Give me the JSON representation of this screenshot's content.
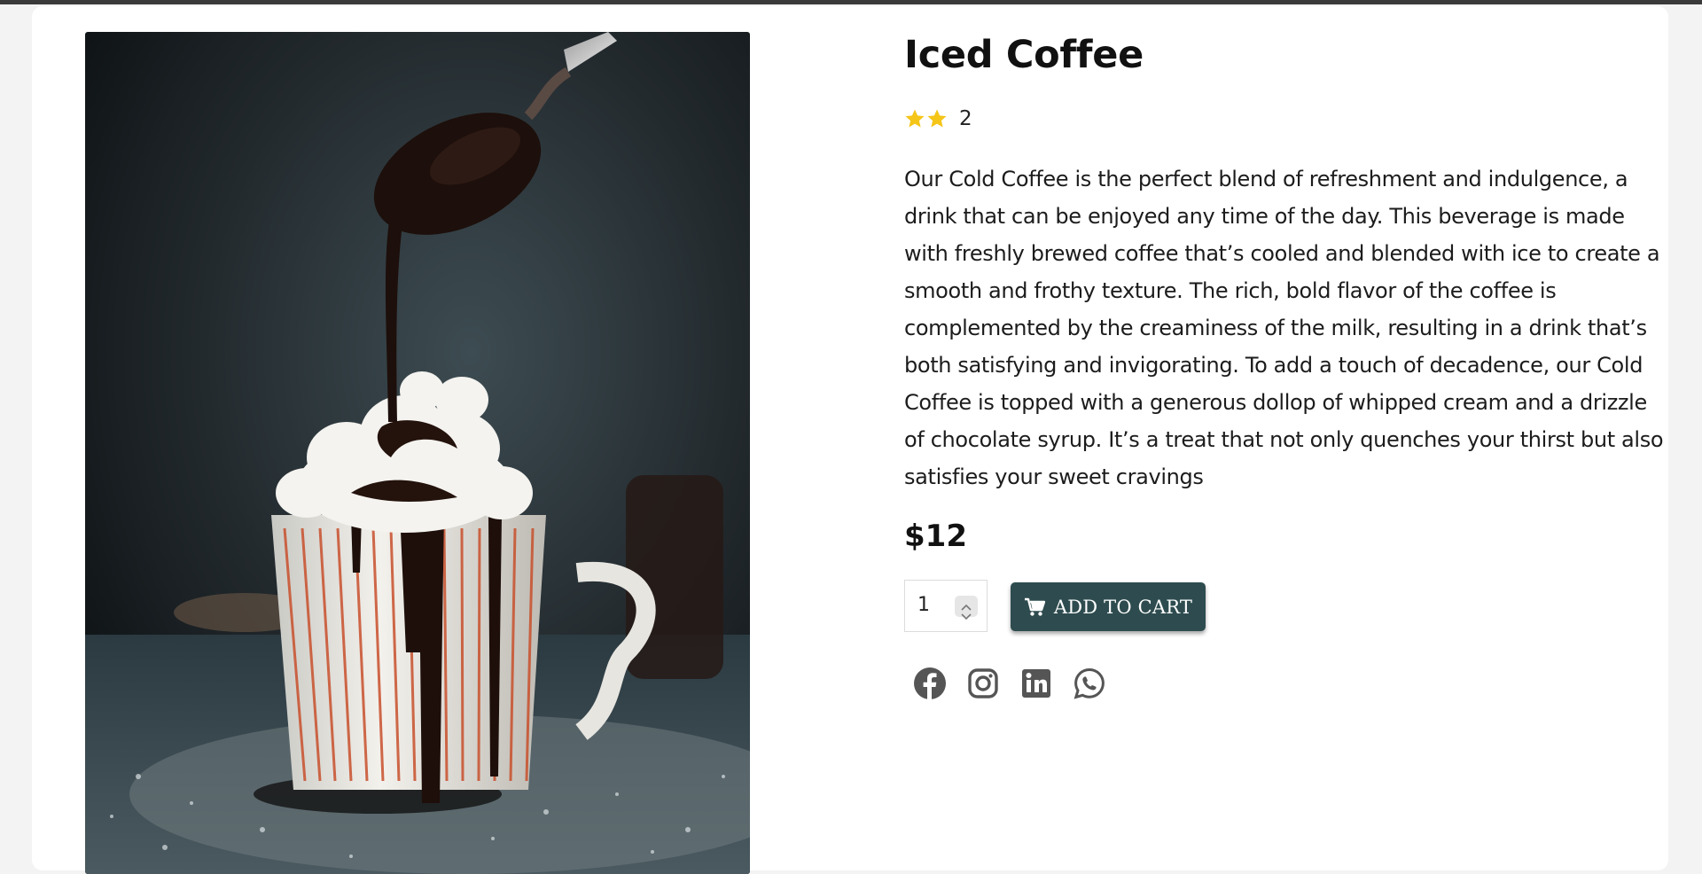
{
  "product": {
    "title": "Iced Coffee",
    "rating_count": "2",
    "stars_filled": 2,
    "description": "Our Cold Coffee is the perfect blend of refreshment and indulgence, a drink that can be enjoyed any time of the day. This beverage is made with freshly brewed coffee that’s cooled and blended with ice to create a smooth and frothy texture. The rich, bold flavor of the coffee is complemented by the creaminess of the milk, resulting in a drink that’s both satisfying and invigorating. To add a touch of decadence, our Cold Coffee is topped with a generous dollop of whipped cream and a drizzle of chocolate syrup. It’s a treat that not only quenches your thirst but also satisfies your sweet cravings",
    "price": "$12",
    "quantity": "1",
    "add_to_cart_label": "ADD TO CART",
    "image_icon": "iced-coffee-photo"
  },
  "social": {
    "icons": [
      "facebook-icon",
      "instagram-icon",
      "linkedin-icon",
      "whatsapp-icon"
    ]
  },
  "colors": {
    "accent_button": "#2e4c4f",
    "star": "#f5c518",
    "social_icon": "#555555",
    "page_background": "#f3f3f3",
    "card_background": "#ffffff"
  }
}
